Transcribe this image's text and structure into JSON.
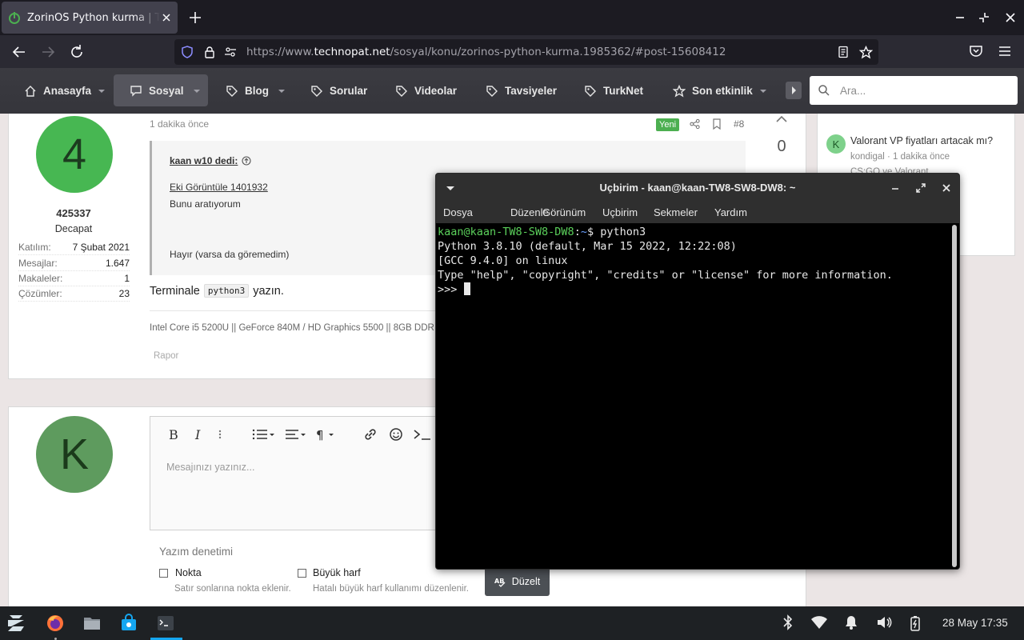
{
  "browser": {
    "tab_title": "ZorinOS Python kurma | Te",
    "url_prefix": "https://www.",
    "url_host": "technopat.net",
    "url_path": "/sosyal/konu/zorinos-python-kurma.1985362/#post-15608412"
  },
  "site_nav": {
    "items": [
      {
        "label": "Anasayfa",
        "icon": "home-icon"
      },
      {
        "label": "Sosyal",
        "icon": "chat-icon"
      },
      {
        "label": "Blog",
        "icon": "tag-icon"
      },
      {
        "label": "Sorular",
        "icon": "tag-icon"
      },
      {
        "label": "Videolar",
        "icon": "tag-icon"
      },
      {
        "label": "Tavsiyeler",
        "icon": "tag-icon"
      },
      {
        "label": "TurkNet",
        "icon": "tag-icon"
      },
      {
        "label": "Son etkinlik",
        "icon": "star-icon"
      }
    ],
    "search_placeholder": "Ara..."
  },
  "post": {
    "avatar_letter": "4",
    "user_name": "425337",
    "user_title": "Decapat",
    "stats": [
      {
        "key": "Katılım:",
        "value": "7 Şubat 2021"
      },
      {
        "key": "Mesajlar:",
        "value": "1.647"
      },
      {
        "key": "Makaleler:",
        "value": "1"
      },
      {
        "key": "Çözümler:",
        "value": "23"
      }
    ],
    "time_ago": "1 dakika önce",
    "badge": "Yeni",
    "post_number": "#8",
    "vote_count": "0",
    "quote": {
      "author": "kaan w10 dedi:",
      "attachment": "Eki Görüntüle 1401932",
      "line1": "Bunu aratıyorum",
      "line2": "Hayır (varsa da göremedim)"
    },
    "reply_before": "Terminale",
    "reply_code": "python3",
    "reply_after": "yazın.",
    "signature": "Intel Core i5 5200U || GeForce 840M / HD Graphics 5500 || 8GB DDR",
    "report": "Rapor"
  },
  "sidebar": {
    "avatar_letter": "K",
    "title": "Valorant VP fiyatları artacak mı?",
    "meta": "kondigal · 1 dakika önce",
    "meta2": "CS:GO ve Valorant"
  },
  "editor": {
    "avatar_letter": "K",
    "placeholder": "Mesajınızı yazınız...",
    "spell_title": "Yazım denetimi",
    "check1_label": "Nokta",
    "check1_desc": "Satır sonlarına nokta eklenir.",
    "check2_label": "Büyük harf",
    "check2_desc": "Hatalı büyük harf kullanımı düzenlenir.",
    "fix_button": "Düzelt"
  },
  "terminal": {
    "title": "Uçbirim - kaan@kaan-TW8-SW8-DW8: ~",
    "menu": [
      "Dosya",
      "Düzenle",
      "Görünüm",
      "Uçbirim",
      "Sekmeler",
      "Yardım"
    ],
    "prompt_user": "kaan@kaan-TW8-SW8-DW8",
    "prompt_path": "~",
    "command": "$ python3",
    "lines": [
      "Python 3.8.10 (default, Mar 15 2022, 12:22:08)",
      "[GCC 9.4.0] on linux",
      "Type \"help\", \"copyright\", \"credits\" or \"license\" for more information."
    ],
    "repl_prompt": ">>> "
  },
  "panel": {
    "clock": "28 May 17:35"
  }
}
